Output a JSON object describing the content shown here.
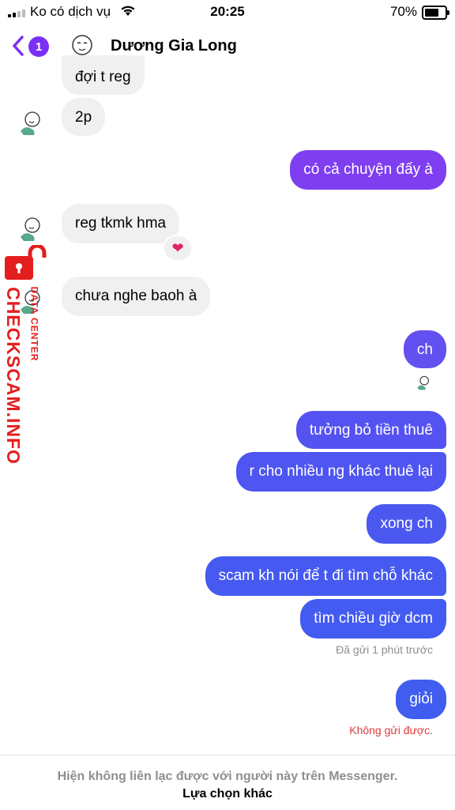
{
  "status_bar": {
    "carrier": "Ko có dịch vụ",
    "time": "20:25",
    "battery": "70%",
    "battery_level": 0.7
  },
  "header": {
    "back_badge": "1",
    "contact_name": "Dương Gia Long"
  },
  "messages": {
    "in_1": "đợi t reg",
    "in_2": "2p",
    "out_1": "có cả chuyện đấy à",
    "in_3": "reg tkmk hma",
    "in_3_reaction": "❤",
    "in_4": "chưa nghe baoh à",
    "out_2": "ch",
    "out_3": "tưởng bỏ tiền thuê",
    "out_4": "r cho nhiều ng khác thuê lại",
    "out_5": "xong ch",
    "out_6": "scam kh nói để t đi tìm chỗ khác",
    "out_7": "tìm chiều giờ dcm",
    "sent_status": "Đã gửi 1 phút trước",
    "out_8": "giỏi",
    "failed_status": "Không gửi được."
  },
  "watermark": {
    "brand": "CHECKSCAM.INFO",
    "sub": "DATA CENTER"
  },
  "footer": {
    "note": "Hiện không liên lạc được với người này trên Messenger.",
    "link": "Lựa chọn khác"
  },
  "colors": {
    "accent": "#7b2ff7",
    "bubble_in": "#f0f0f0",
    "error": "#e03a3a",
    "watermark": "#e41e1e"
  }
}
